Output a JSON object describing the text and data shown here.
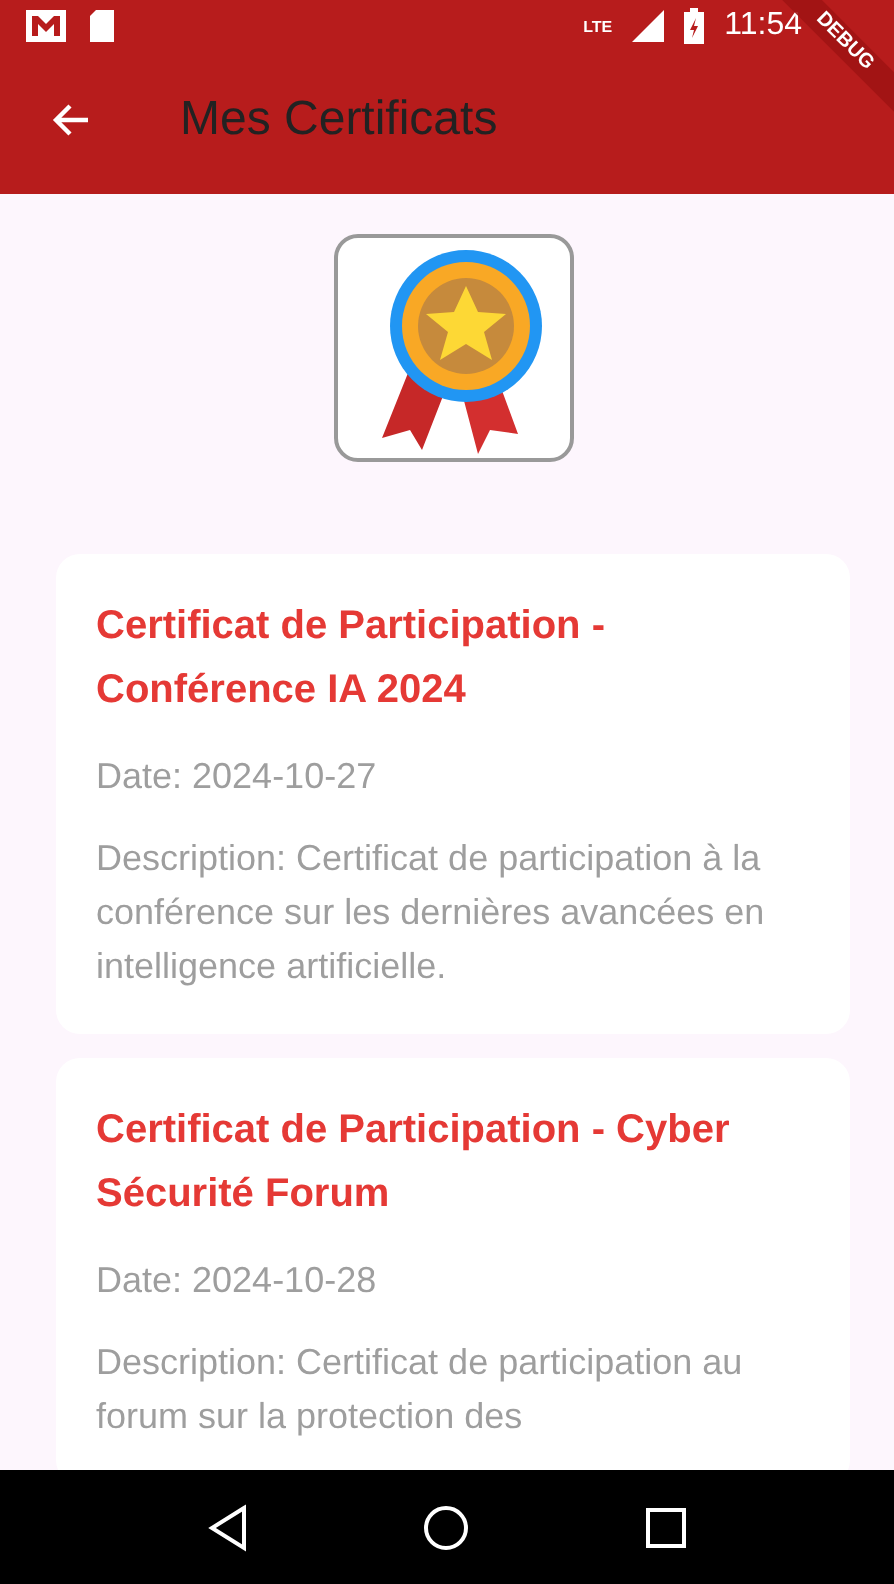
{
  "status_bar": {
    "time": "11:54",
    "network": "LTE"
  },
  "debug_banner": "DEBUG",
  "app_bar": {
    "title": "Mes Certificats"
  },
  "certificates": [
    {
      "title": "Certificat de Participation - Conférence IA 2024",
      "date": "Date: 2024-10-27",
      "description": "Description: Certificat de participation à la conférence sur les dernières avancées en intelligence artificielle."
    },
    {
      "title": "Certificat de Participation - Cyber Sécurité Forum",
      "date": "Date: 2024-10-28",
      "description": "Description: Certificat de participation au forum sur la protection des"
    }
  ]
}
